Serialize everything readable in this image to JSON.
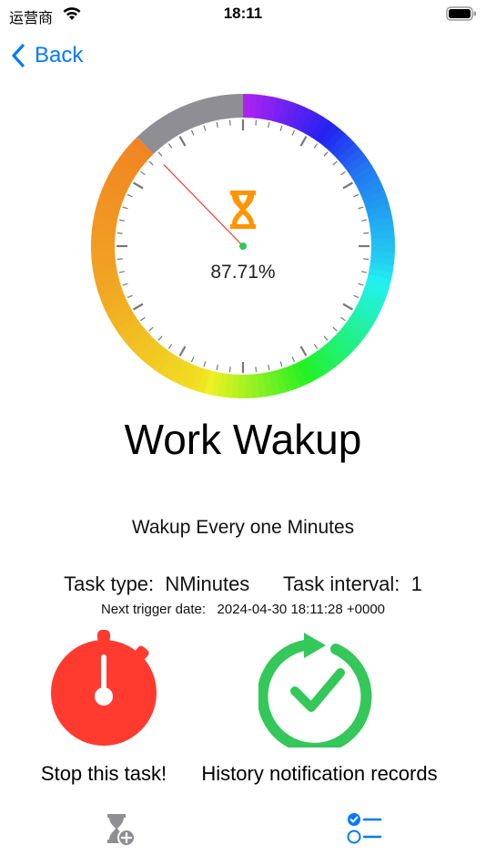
{
  "status_bar": {
    "carrier": "运营商",
    "time": "18:11"
  },
  "nav": {
    "back_label": "Back"
  },
  "dial": {
    "percent_text": "87.71%",
    "progress_fraction": 0.8771,
    "remaining_color": "#8e8e93",
    "hand_color": "#ff3b30",
    "center_dot_color": "#34c759",
    "hourglass_color": "#ff9500"
  },
  "task": {
    "title": "Work Wakup",
    "description": "Wakup Every one Minutes",
    "type_label": "Task type:",
    "type_value": "NMinutes",
    "interval_label": "Task interval:",
    "interval_value": "1",
    "next_trigger_label": "Next trigger date:",
    "next_trigger_value": "2024-04-30 18:11:28 +0000"
  },
  "actions": {
    "stop_label": "Stop this task!",
    "stop_color": "#ff3b30",
    "history_label": "History notification records",
    "history_color": "#34c759"
  },
  "tabs": {
    "timer_icon": "hourglass-add-icon",
    "list_icon": "checklist-icon",
    "accent": "#007aff"
  }
}
